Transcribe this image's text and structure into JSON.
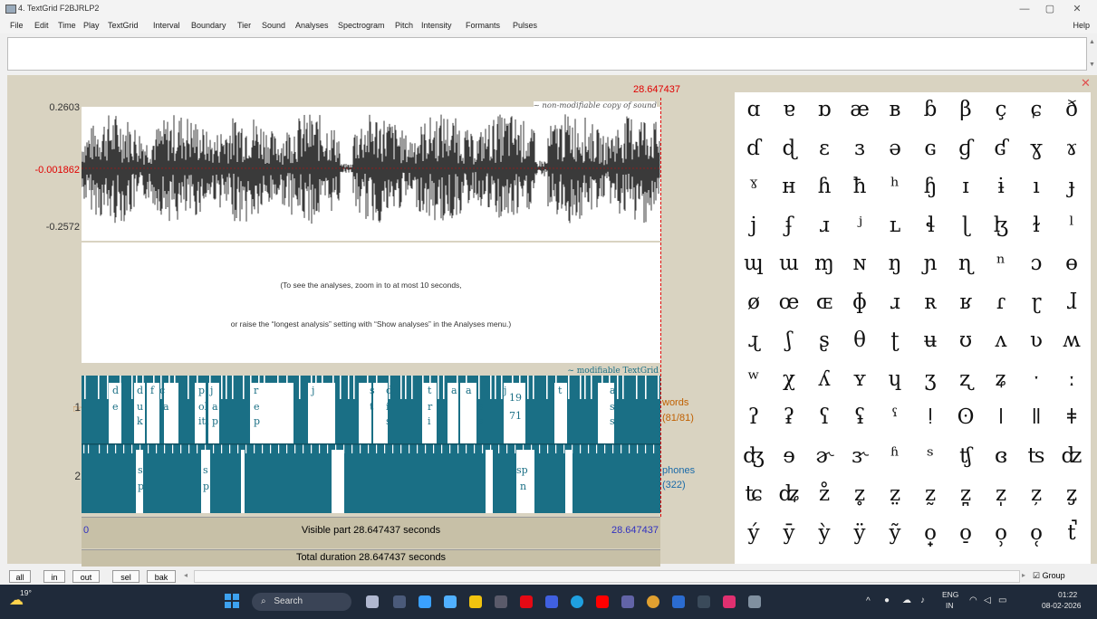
{
  "window": {
    "title": "4. TextGrid F2BJRLP2",
    "min": "—",
    "max": "▢",
    "close": "✕"
  },
  "menu": {
    "items": [
      "File",
      "Edit",
      "Time",
      "Play",
      "TextGrid",
      "Interval",
      "Boundary",
      "Tier",
      "Sound",
      "Analyses",
      "Spectrogram",
      "Pitch",
      "Intensity",
      "Formants",
      "Pulses"
    ],
    "help": "Help"
  },
  "editor": {
    "cursor_time": "28.647437",
    "y_top": "0.2603",
    "y_mid": "-0.001862",
    "y_bottom": "-0.2572",
    "sound_label": "~ non-modifiable copy of sound",
    "textgrid_label": "~ modifiable TextGrid",
    "analysis_msg1": "(To see the analyses, zoom in to at most 10 seconds,",
    "analysis_msg2": "or raise the “longest analysis” setting with “Show analyses” in the Analyses menu.)",
    "tier1_num": "1",
    "tier2_num": "2",
    "tier1_name": "words",
    "tier1_count": "(81/81)",
    "tier2_name": "phones",
    "tier2_count": "(322)",
    "start": "0",
    "end": "28.647437",
    "visible_part": "Visible part 28.647437 seconds",
    "total_duration": "Total duration 28.647437 seconds",
    "close_icon": "✕"
  },
  "words_labels": [
    "d",
    "e",
    "d",
    "u",
    "k",
    "f",
    "c",
    "a",
    "p",
    "ol",
    "iti",
    "j",
    "a",
    "p",
    "r",
    "e",
    "p",
    "j",
    "s",
    "t",
    "d",
    "i",
    "s",
    "t",
    "r",
    "i",
    "a",
    "a",
    "s",
    "s",
    "j",
    "19",
    "71",
    "t",
    "a",
    "s",
    "s"
  ],
  "phones_labels": [
    "s",
    "p",
    "s",
    "p",
    "sp",
    "n"
  ],
  "ipa_rows": [
    [
      "ɑ",
      "ɐ",
      "ɒ",
      "æ",
      "ʙ",
      "ɓ",
      "β",
      "ç",
      "ɕ",
      "ð"
    ],
    [
      "ɗ",
      "ɖ",
      "ɛ",
      "ɜ",
      "ə",
      "ɢ",
      "ɠ",
      "ʛ",
      "ɣ",
      "ɤ"
    ],
    [
      "ˠ",
      "ʜ",
      "ɦ",
      "ħ",
      "ʰ",
      "ɧ",
      "ɪ",
      "ɨ",
      "ı",
      "ɟ"
    ],
    [
      "j",
      "ʄ",
      "ɹ",
      "ʲ",
      "ʟ",
      "ɬ",
      "ɭ",
      "ɮ",
      "ɫ",
      "ˡ"
    ],
    [
      "ɰ",
      "ɯ",
      "ɱ",
      "ɴ",
      "ŋ",
      "ɲ",
      "ɳ",
      "ⁿ",
      "ɔ",
      "ɵ"
    ],
    [
      "ø",
      "œ",
      "ɶ",
      "ɸ",
      "ɹ",
      "ʀ",
      "ʁ",
      "ɾ",
      "ɽ",
      "ɺ"
    ],
    [
      "ɻ",
      "ʃ",
      "ʂ",
      "θ",
      "ʈ",
      "ʉ",
      "ʊ",
      "ʌ",
      "ʋ",
      "ʍ"
    ],
    [
      "ʷ",
      "χ",
      "ʎ",
      "ʏ",
      "ɥ",
      "ʒ",
      "ʐ",
      "ʑ",
      "ˑ",
      "ː"
    ],
    [
      "ʔ",
      "ʡ",
      "ʕ",
      "ʢ",
      "ˤ",
      "ǃ",
      "ʘ",
      "ǀ",
      "ǁ",
      "ǂ"
    ],
    [
      "ʤ",
      "ɘ",
      "ɚ",
      "ɝ",
      "ʱ",
      "ˢ",
      "ʧ",
      "ɞ",
      "ʦ",
      "ʣ"
    ],
    [
      "ʨ",
      "ʥ",
      "z̊",
      "z̥",
      "z̤",
      "z̰",
      "z̪",
      "z̩",
      "z̦",
      "z̡"
    ],
    [
      "ý",
      "ȳ",
      "ỳ",
      "ÿ",
      "ỹ",
      "o̟",
      "o̠",
      "o̹",
      "o̜",
      "t̚"
    ]
  ],
  "bottom": {
    "buttons": [
      "all",
      "in",
      "out",
      "sel",
      "bak"
    ],
    "group_label": "Group",
    "group_checked": "☑"
  },
  "taskbar": {
    "weather": "19°",
    "search": "Search",
    "lang": "ENG",
    "region": "IN",
    "time": "01:22",
    "date": "08-02-2026"
  },
  "colors": {
    "textgrid_teal": "#1a6f85",
    "cursor_red": "#e00000",
    "panel_beige": "#d9d3c1"
  }
}
